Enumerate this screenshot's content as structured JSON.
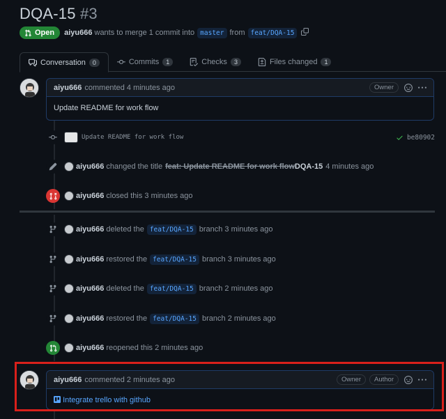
{
  "pr": {
    "title": "DQA-15",
    "number": "#3",
    "state": "Open",
    "author": "aiyu666",
    "merge_text": "wants to merge 1 commit into",
    "base_branch": "master",
    "from_text": "from",
    "head_branch": "feat/DQA-15"
  },
  "tabs": [
    {
      "label": "Conversation",
      "count": "0"
    },
    {
      "label": "Commits",
      "count": "1"
    },
    {
      "label": "Checks",
      "count": "3"
    },
    {
      "label": "Files changed",
      "count": "1"
    }
  ],
  "comment1": {
    "author": "aiyu666",
    "action": "commented 4 minutes ago",
    "role": "Owner",
    "body": "Update README for work flow"
  },
  "commit": {
    "message": "Update README for work flow",
    "sha": "be80902"
  },
  "events": {
    "rename": {
      "author": "aiyu666",
      "action": "changed the title",
      "old": "feat: Update README for work flow",
      "new": "DQA-15",
      "time": "4 minutes ago"
    },
    "closed": {
      "author": "aiyu666",
      "action": "closed this 3 minutes ago"
    },
    "deleted1": {
      "author": "aiyu666",
      "action": "deleted the",
      "branch": "feat/DQA-15",
      "suffix": "branch 3 minutes ago"
    },
    "restored1": {
      "author": "aiyu666",
      "action": "restored the",
      "branch": "feat/DQA-15",
      "suffix": "branch 3 minutes ago"
    },
    "deleted2": {
      "author": "aiyu666",
      "action": "deleted the",
      "branch": "feat/DQA-15",
      "suffix": "branch 2 minutes ago"
    },
    "restored2": {
      "author": "aiyu666",
      "action": "restored the",
      "branch": "feat/DQA-15",
      "suffix": "branch 2 minutes ago"
    },
    "reopened": {
      "author": "aiyu666",
      "action": "reopened this 2 minutes ago"
    }
  },
  "comment2": {
    "author": "aiyu666",
    "action": "commented 2 minutes ago",
    "role1": "Owner",
    "role2": "Author",
    "link": "Integrate trello with github"
  },
  "colors": {
    "background": "#0d1117",
    "open_green": "#238636",
    "closed_red": "#da3633",
    "link_blue": "#58a6ff",
    "highlight_red": "#d9201b"
  }
}
